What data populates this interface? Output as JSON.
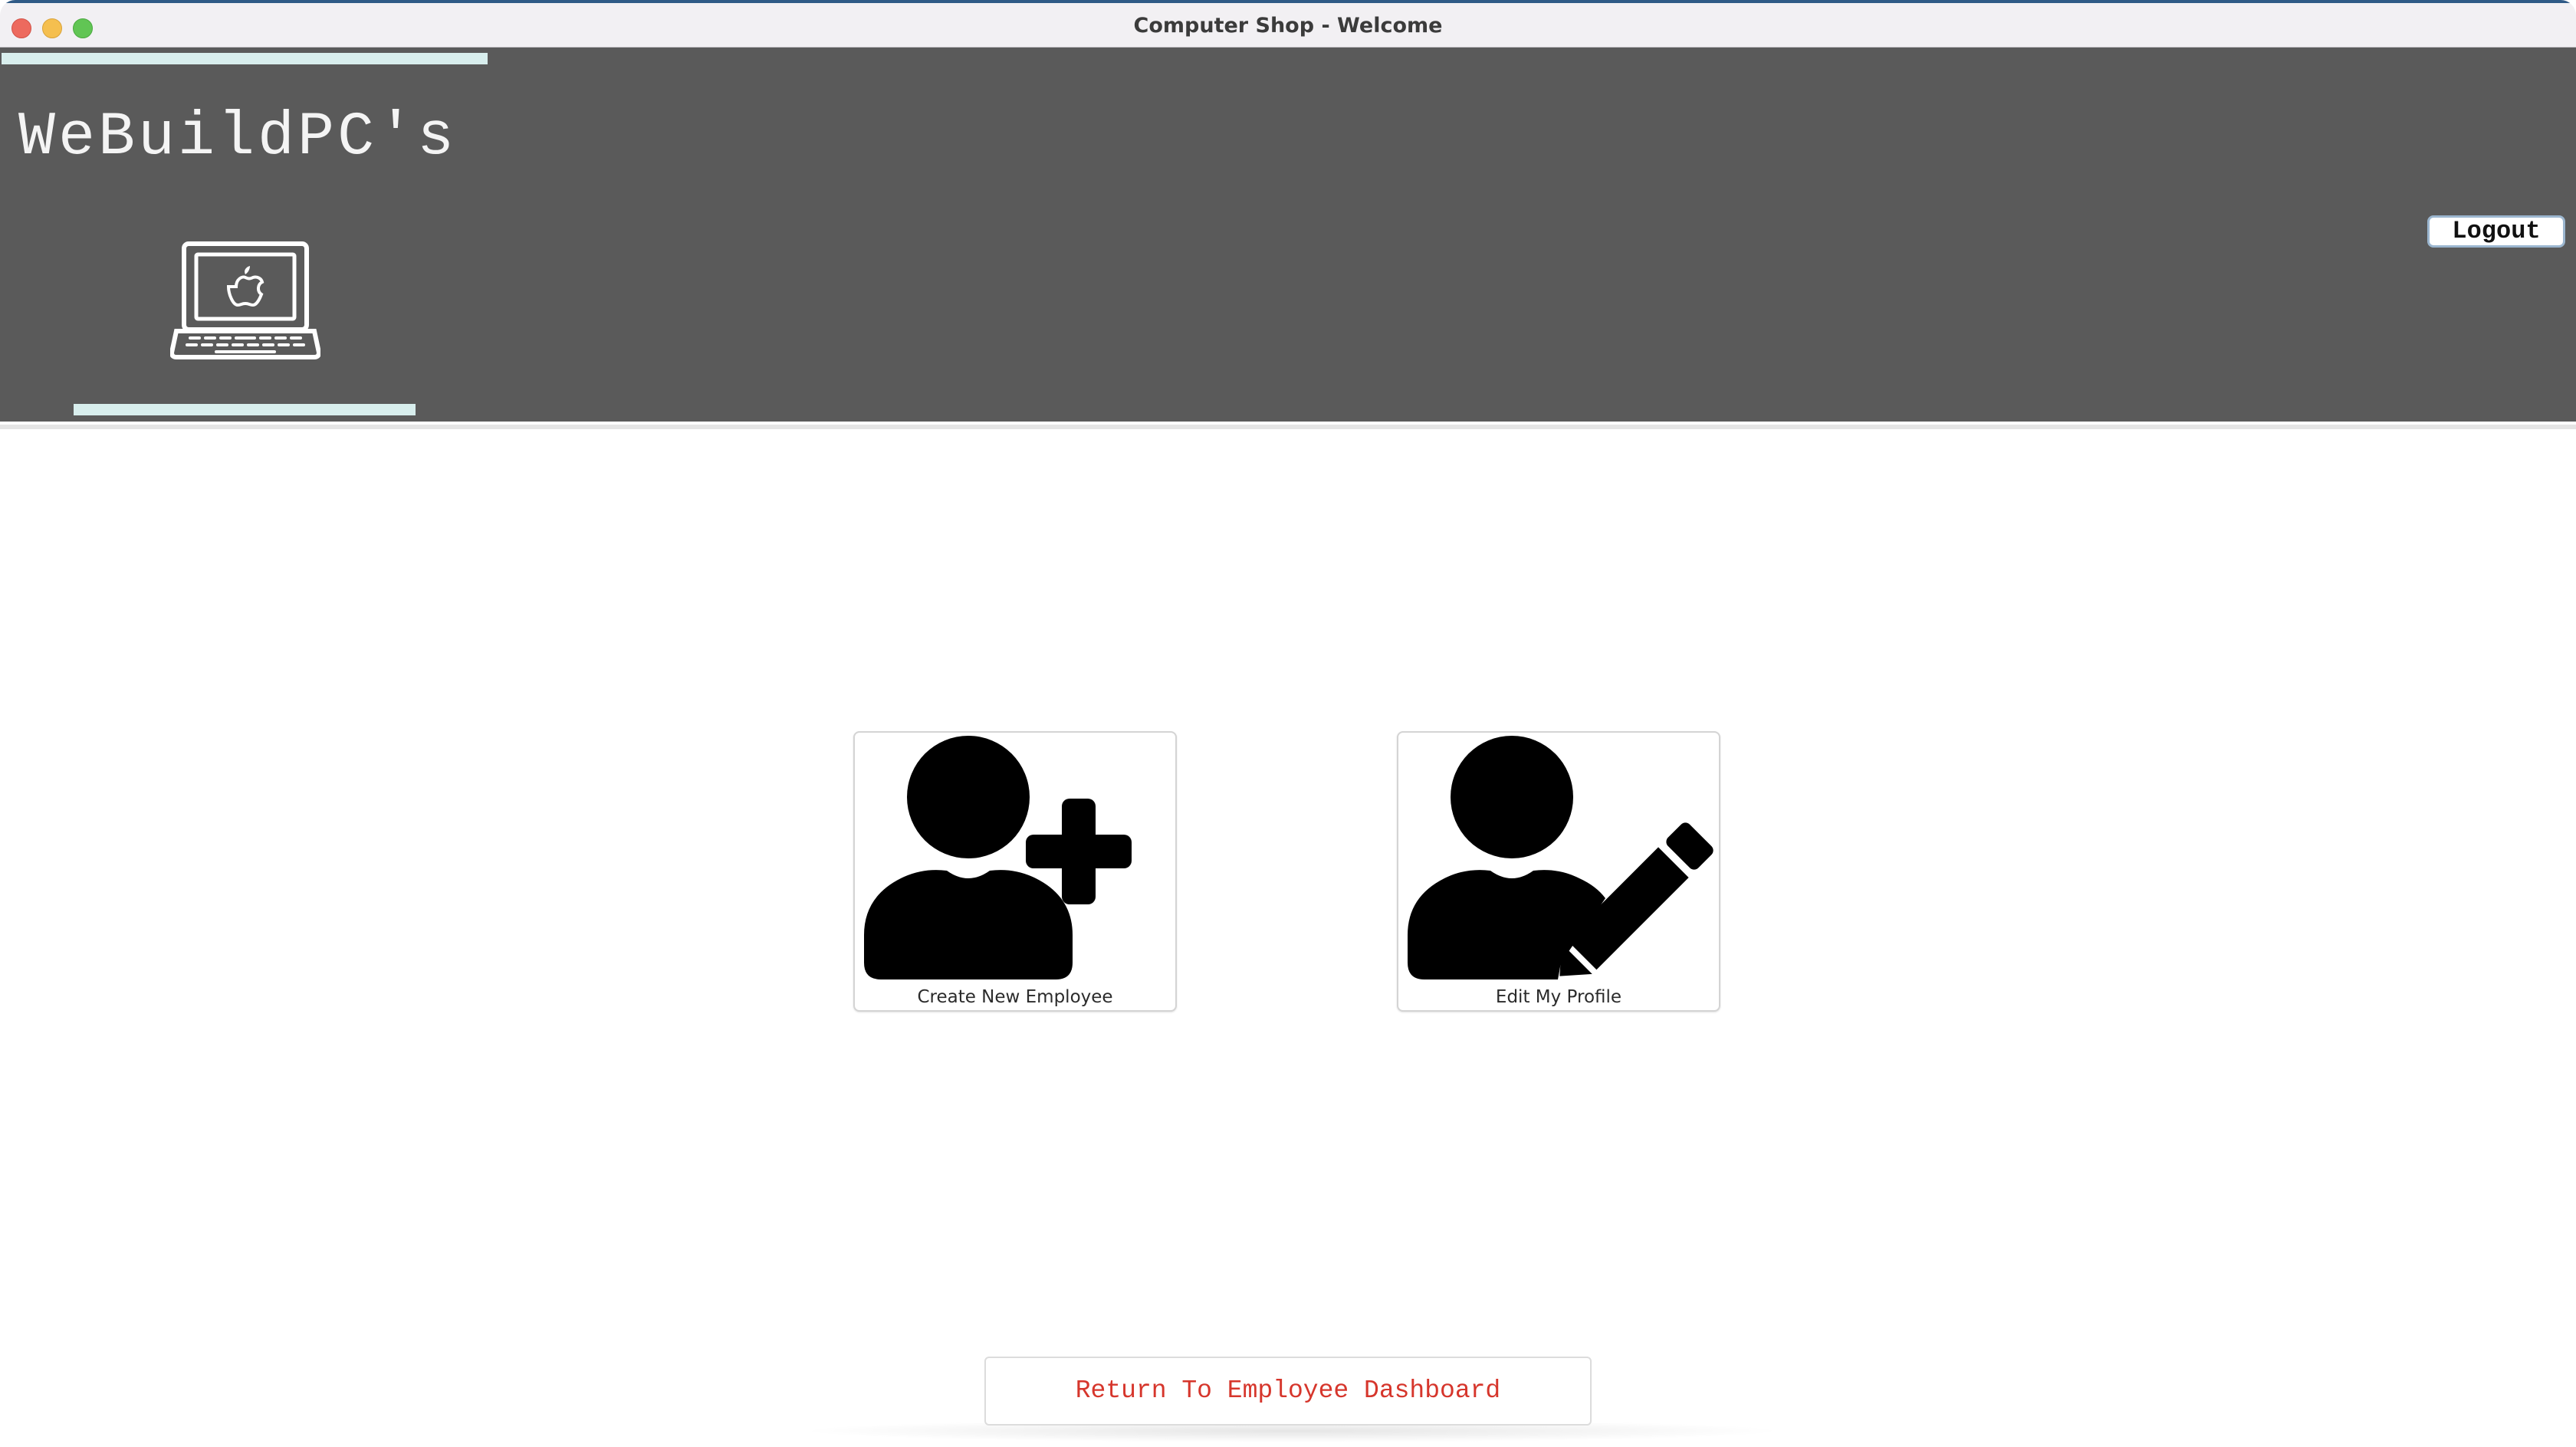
{
  "window": {
    "title": "Computer Shop - Welcome"
  },
  "header": {
    "brand": "WeBuildPC's",
    "logo_icon": "laptop-apple-icon",
    "logout_label": "Logout"
  },
  "actions": [
    {
      "label": "Create New Employee",
      "icon": "add-user-icon"
    },
    {
      "label": "Edit My Profile",
      "icon": "edit-user-icon"
    }
  ],
  "footer": {
    "return_label": "Return To Employee Dashboard"
  },
  "colors": {
    "header_bg": "#5a5a5a",
    "accent_bar": "#d8eeed",
    "return_text": "#d6362c"
  }
}
